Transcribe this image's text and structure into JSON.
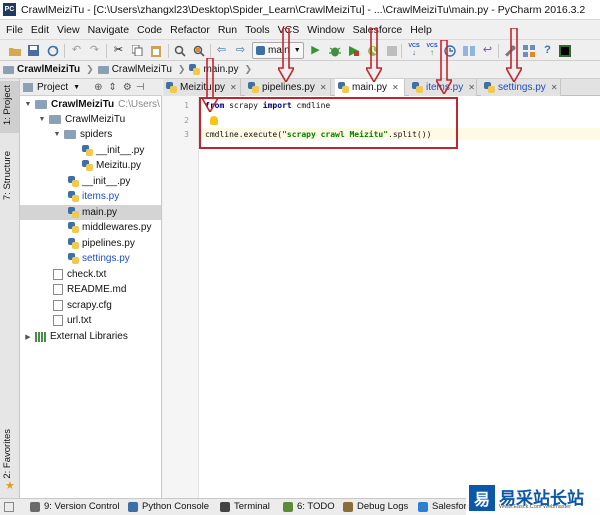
{
  "window": {
    "app_icon_label": "PC",
    "title": "CrawlMeiziTu - [C:\\Users\\zhangxl23\\Desktop\\Spider_Learn\\CrawlMeiziTu] - ...\\CrawlMeiziTu\\main.py - PyCharm 2016.3.2"
  },
  "menu": [
    "File",
    "Edit",
    "View",
    "Navigate",
    "Code",
    "Refactor",
    "Run",
    "Tools",
    "VCS",
    "Window",
    "Salesforce",
    "Help"
  ],
  "toolbar": {
    "run_config": "main",
    "vcs1": "VCS",
    "vcs2": "VCS"
  },
  "breadcrumbs": [
    "CrawlMeiziTu",
    "CrawlMeiziTu",
    "main.py"
  ],
  "side_tabs": {
    "project": "1: Project",
    "structure": "7: Structure",
    "favorites": "2: Favorites"
  },
  "project_panel": {
    "header": "Project"
  },
  "tree": [
    {
      "label": "CrawlMeiziTu",
      "suffix": "C:\\Users\\",
      "kind": "folder",
      "expanded": true,
      "bold": true
    },
    {
      "label": "CrawlMeiziTu",
      "kind": "folder",
      "expanded": true
    },
    {
      "label": "spiders",
      "kind": "folder",
      "expanded": true
    },
    {
      "label": "__init__.py",
      "kind": "py"
    },
    {
      "label": "Meizitu.py",
      "kind": "py"
    },
    {
      "label": "__init__.py",
      "kind": "py"
    },
    {
      "label": "items.py",
      "kind": "py",
      "modified": true
    },
    {
      "label": "main.py",
      "kind": "py",
      "selected": true
    },
    {
      "label": "middlewares.py",
      "kind": "py"
    },
    {
      "label": "pipelines.py",
      "kind": "py"
    },
    {
      "label": "settings.py",
      "kind": "py",
      "modified": true
    },
    {
      "label": "check.txt",
      "kind": "file"
    },
    {
      "label": "README.md",
      "kind": "file"
    },
    {
      "label": "scrapy.cfg",
      "kind": "file"
    },
    {
      "label": "url.txt",
      "kind": "file"
    },
    {
      "label": "External Libraries",
      "kind": "lib",
      "expanded": false
    }
  ],
  "tabs": [
    {
      "label": "Meizitu.py",
      "active": false
    },
    {
      "label": "pipelines.py",
      "active": false
    },
    {
      "label": "main.py",
      "active": true
    },
    {
      "label": "items.py",
      "active": false,
      "modified": true
    },
    {
      "label": "settings.py",
      "active": false,
      "modified": true
    }
  ],
  "editor": {
    "line_numbers": [
      "1",
      "2",
      "3"
    ],
    "line1": {
      "kw1": "from",
      "mod": " scrapy ",
      "kw2": "import",
      "name": " cmdline"
    },
    "line3": {
      "pre": "cmdline.execute(",
      "str": "\"scrapy crawl Meizitu\"",
      "post": ".split())"
    }
  },
  "bottom_tools": [
    {
      "label": "9: Version Control",
      "color": "#6a6a6a"
    },
    {
      "label": "Python Console",
      "color": "#3d6fa8"
    },
    {
      "label": "Terminal",
      "color": "#444444"
    },
    {
      "label": "6: TODO",
      "color": "#5b8c3a"
    },
    {
      "label": "Debug Logs",
      "color": "#8a6d3b"
    },
    {
      "label": "Salesforce",
      "color": "#2a7fd4"
    }
  ],
  "watermark": {
    "logo": "易",
    "name": "易采站长站",
    "tagline": "Www.Easck.Com Webmaster"
  },
  "colors": {
    "annotation_red": "#c0262d",
    "selection": "#d4d4d4",
    "keyword": "#000080",
    "string": "#008000"
  }
}
